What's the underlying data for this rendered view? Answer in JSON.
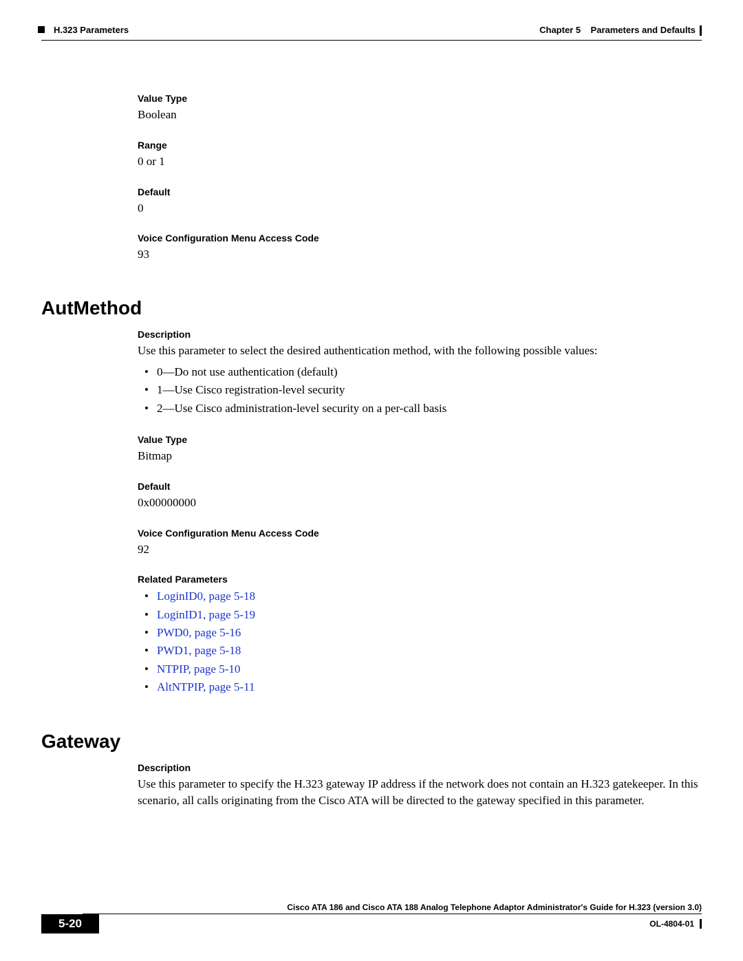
{
  "header": {
    "left": "H.323 Parameters",
    "chapter": "Chapter 5",
    "chapterTitle": "Parameters and Defaults"
  },
  "block1": {
    "valueTypeLabel": "Value Type",
    "valueType": "Boolean",
    "rangeLabel": "Range",
    "range": "0 or 1",
    "defaultLabel": "Default",
    "default": "0",
    "accessCodeLabel": "Voice Configuration Menu Access Code",
    "accessCode": "93"
  },
  "autmethod": {
    "heading": "AutMethod",
    "descLabel": "Description",
    "desc": "Use this parameter to select the desired authentication method, with the following possible values:",
    "items": [
      "0—Do not use authentication (default)",
      "1—Use Cisco registration-level security",
      "2—Use Cisco administration-level security on a per-call basis"
    ],
    "valueTypeLabel": "Value Type",
    "valueType": "Bitmap",
    "defaultLabel": "Default",
    "default": "0x00000000",
    "accessCodeLabel": "Voice Configuration Menu Access Code",
    "accessCode": "92",
    "relatedLabel": "Related Parameters",
    "related": [
      "LoginID0, page 5-18",
      "LoginID1, page 5-19",
      "PWD0, page 5-16",
      "PWD1, page 5-18",
      "NTPIP, page 5-10",
      "AltNTPIP, page 5-11"
    ]
  },
  "gateway": {
    "heading": "Gateway",
    "descLabel": "Description",
    "desc": "Use this parameter to specify the H.323 gateway IP address if the network does not contain an H.323 gatekeeper. In this scenario, all calls originating from the Cisco ATA will be directed to the gateway specified in this parameter."
  },
  "footer": {
    "guide": "Cisco ATA 186 and Cisco ATA 188 Analog Telephone Adaptor Administrator's Guide for H.323 (version 3.0)",
    "page": "5-20",
    "docnum": "OL-4804-01"
  }
}
